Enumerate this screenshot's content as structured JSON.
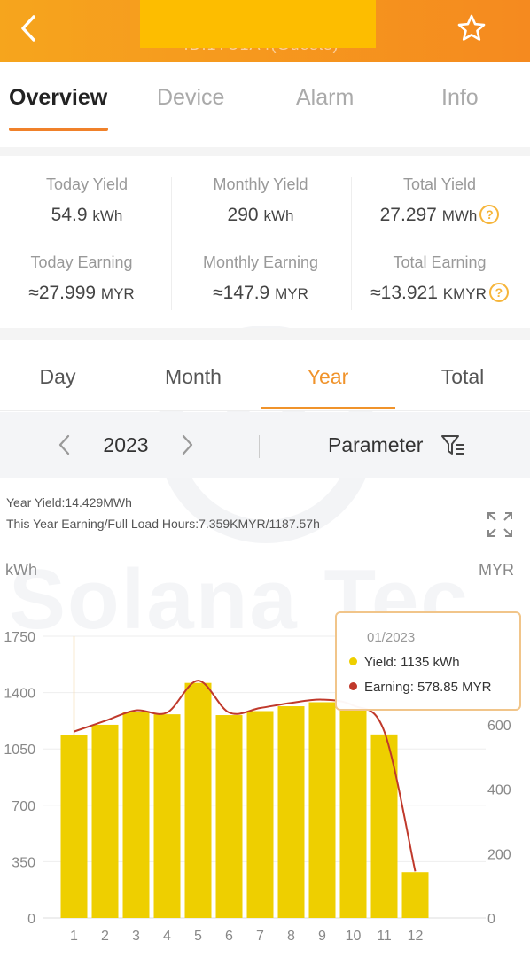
{
  "header": {
    "subtitle": "ID:1TU1A4(Guests)",
    "back_icon": "chevron-left-icon",
    "favorite_icon": "star-outline-icon"
  },
  "top_tabs": [
    {
      "label": "Overview",
      "active": true
    },
    {
      "label": "Device",
      "active": false
    },
    {
      "label": "Alarm",
      "active": false
    },
    {
      "label": "Info",
      "active": false
    }
  ],
  "stats": {
    "today_yield": {
      "label": "Today Yield",
      "value": "54.9",
      "unit": "kWh"
    },
    "monthly_yield": {
      "label": "Monthly Yield",
      "value": "290",
      "unit": "kWh"
    },
    "total_yield": {
      "label": "Total Yield",
      "value": "27.297",
      "unit": "MWh"
    },
    "today_earning": {
      "label": "Today Earning",
      "value": "≈27.999",
      "unit": "MYR"
    },
    "monthly_earning": {
      "label": "Monthly Earning",
      "value": "≈147.9",
      "unit": "MYR"
    },
    "total_earning": {
      "label": "Total Earning",
      "value": "≈13.921",
      "unit": "KMYR"
    },
    "help_glyph": "?"
  },
  "period_tabs": [
    {
      "label": "Day",
      "active": false
    },
    {
      "label": "Month",
      "active": false
    },
    {
      "label": "Year",
      "active": true
    },
    {
      "label": "Total",
      "active": false
    }
  ],
  "selector": {
    "year": "2023",
    "parameter_label": "Parameter"
  },
  "chart_info": {
    "year_yield": "Year Yield:14.429MWh",
    "earning_hours": "This Year Earning/Full Load Hours:7.359KMYR/1187.57h"
  },
  "watermark": "Solana Tec",
  "tooltip": {
    "title": "01/2023",
    "yield_text": "Yield:  1135 kWh",
    "earning_text": "Earning:  578.85 MYR"
  },
  "colors": {
    "accent": "#f0932b",
    "bar": "#eecf00",
    "line": "#c0392b"
  },
  "chart_data": {
    "type": "bar",
    "categories": [
      "1",
      "2",
      "3",
      "4",
      "5",
      "6",
      "7",
      "8",
      "9",
      "10",
      "11",
      "12"
    ],
    "left_axis_label": "kWh",
    "right_axis_label": "MYR",
    "left_ticks": [
      0,
      350,
      700,
      1050,
      1400,
      1750
    ],
    "right_ticks": [
      0,
      200,
      400,
      600
    ],
    "ylim_left": [
      0,
      1750
    ],
    "ylim_right": [
      0,
      875
    ],
    "series": [
      {
        "name": "Yield",
        "axis": "left",
        "type": "bar",
        "values": [
          1135,
          1200,
          1280,
          1265,
          1460,
          1260,
          1285,
          1315,
          1340,
          1300,
          1140,
          285
        ]
      },
      {
        "name": "Earning",
        "axis": "right",
        "type": "line",
        "values": [
          578.85,
          612,
          645,
          638,
          737,
          638,
          652,
          668,
          678,
          660,
          580,
          145
        ]
      }
    ]
  }
}
